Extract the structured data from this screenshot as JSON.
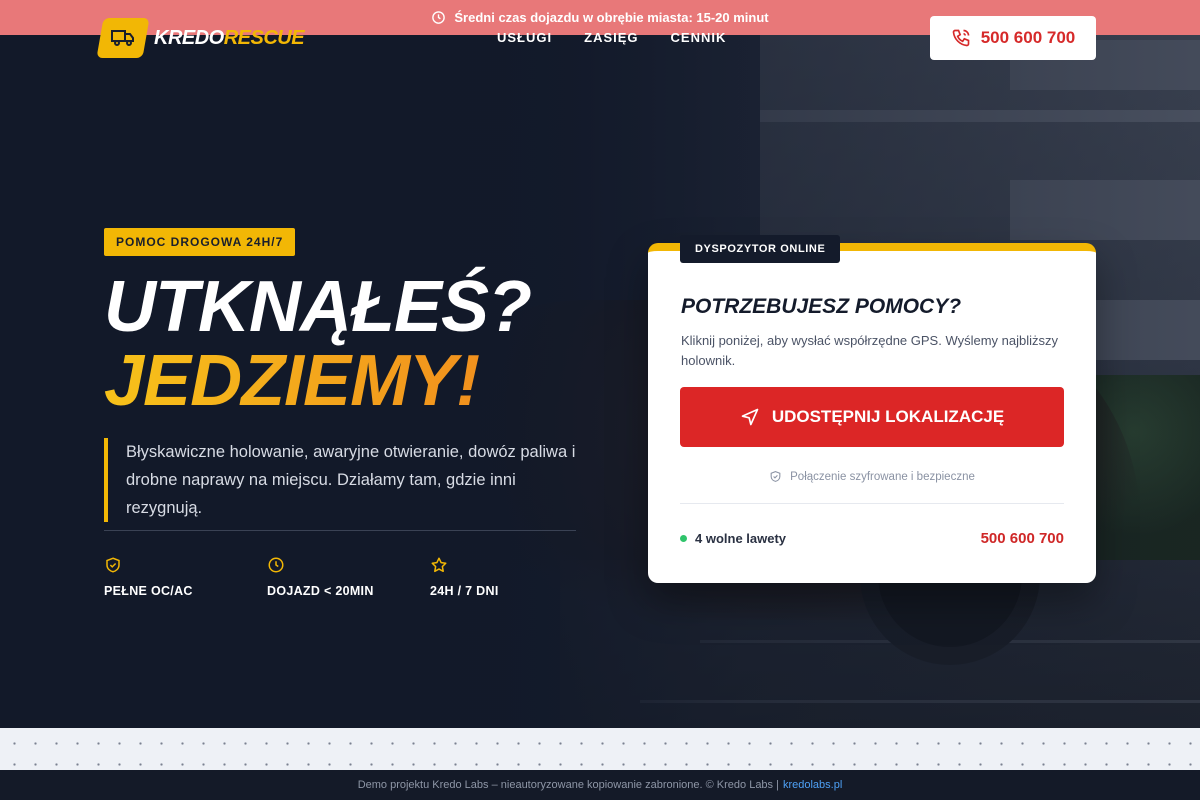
{
  "topbar": {
    "icon": "clock-icon",
    "text": "Średni czas dojazdu w obrębie miasta: 15-20 minut"
  },
  "logo": {
    "part1": "KREDO",
    "part2": "RESCUE",
    "icon": "truck-icon",
    "accent": "#f2b705"
  },
  "nav": {
    "items": [
      "USŁUGI",
      "ZASIĘG",
      "CENNIK"
    ]
  },
  "header_phone": {
    "icon": "phone-icon",
    "number": "500 600 700"
  },
  "hero": {
    "tag": "POMOC DROGOWA 24H/7",
    "title_line1": "UTKNĄŁEŚ?",
    "title_line2": "JEDZIEMY!",
    "lead": "Błyskawiczne holowanie, awaryjne otwieranie, dowóz paliwa i drobne naprawy na miejscu. Działamy tam, gdzie inni rezygnują.",
    "features": [
      {
        "icon": "shield-check-icon",
        "label": "PEŁNE OC/AC"
      },
      {
        "icon": "clock-icon",
        "label": "DOJAZD < 20MIN"
      },
      {
        "icon": "star-icon",
        "label": "24H / 7 DNI"
      }
    ]
  },
  "card": {
    "badge": "DYSPOZYTOR ONLINE",
    "title": "POTRZEBUJESZ POMOCY?",
    "description": "Kliknij poniżej, aby wysłać współrzędne GPS. Wyślemy najbliższy holownik.",
    "button_label": "UDOSTĘPNIJ LOKALIZACJĘ",
    "button_icon": "navigation-arrow-icon",
    "secure_text": "Połączenie szyfrowane i bezpieczne",
    "status_text": "4 wolne lawety",
    "phone": "500 600 700",
    "button_color": "#dc2626",
    "status_color": "#2fc46b"
  },
  "footer": {
    "text": "Demo projektu Kredo Labs – nieautoryzowane kopiowanie zabronione. © Kredo Labs |",
    "link": "kredolabs.pl"
  }
}
